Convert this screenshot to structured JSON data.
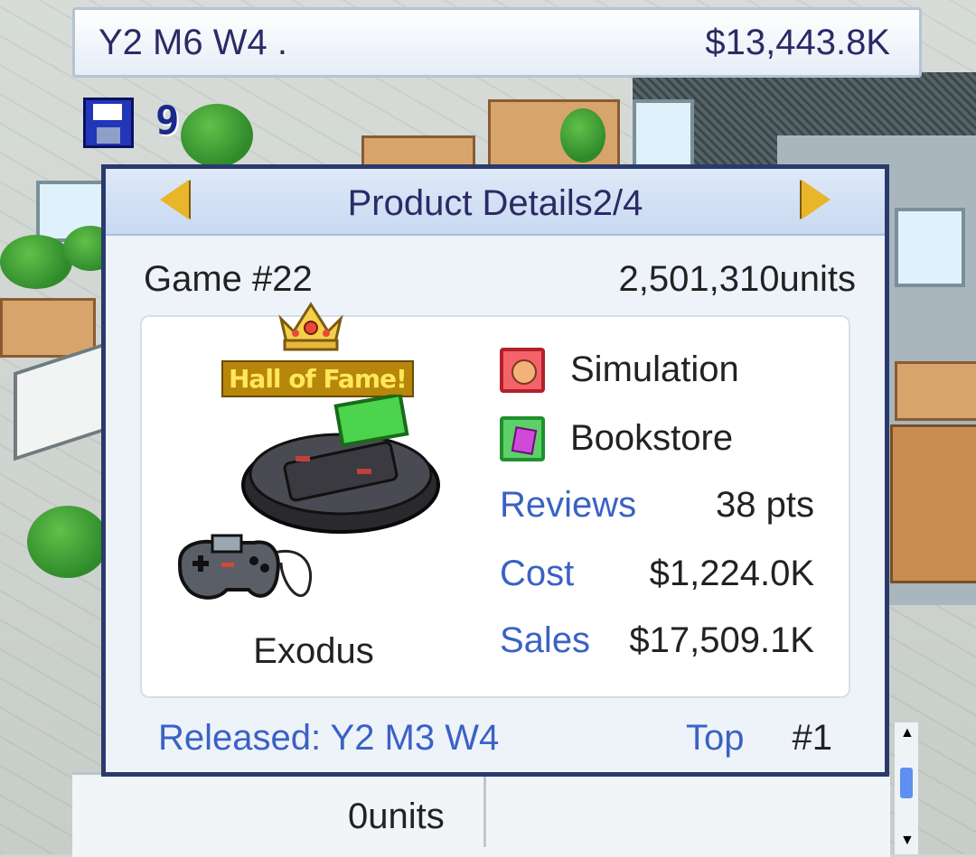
{
  "status_bar": {
    "date": "Y2 M6 W4 .",
    "funds": "$13,443.8K"
  },
  "save_slot": {
    "icon": "floppy-disk-icon",
    "count": "9"
  },
  "dialog": {
    "title": "Product Details2/4",
    "game_number": "Game #22",
    "units_sold": "2,501,310units",
    "hall_of_fame": "Hall of Fame!",
    "product_name": "Exodus",
    "genre": {
      "label": "Simulation",
      "icon": "face-genre-icon"
    },
    "type": {
      "label": "Bookstore",
      "icon": "gem-type-icon"
    },
    "stats": {
      "reviews_label": "Reviews",
      "reviews_value": "38 pts",
      "cost_label": "Cost",
      "cost_value": "$1,224.0K",
      "sales_label": "Sales",
      "sales_value": "$17,509.1K"
    },
    "released": "Released: Y2 M3 W4",
    "top_label": "Top",
    "top_rank": "#1"
  },
  "bottom_panel": {
    "units": "0units"
  },
  "colors": {
    "title_text": "#2b2a66",
    "label_blue": "#3a62c4",
    "dialog_border": "#2a3a6a",
    "dialog_bg": "#eef3fa"
  }
}
